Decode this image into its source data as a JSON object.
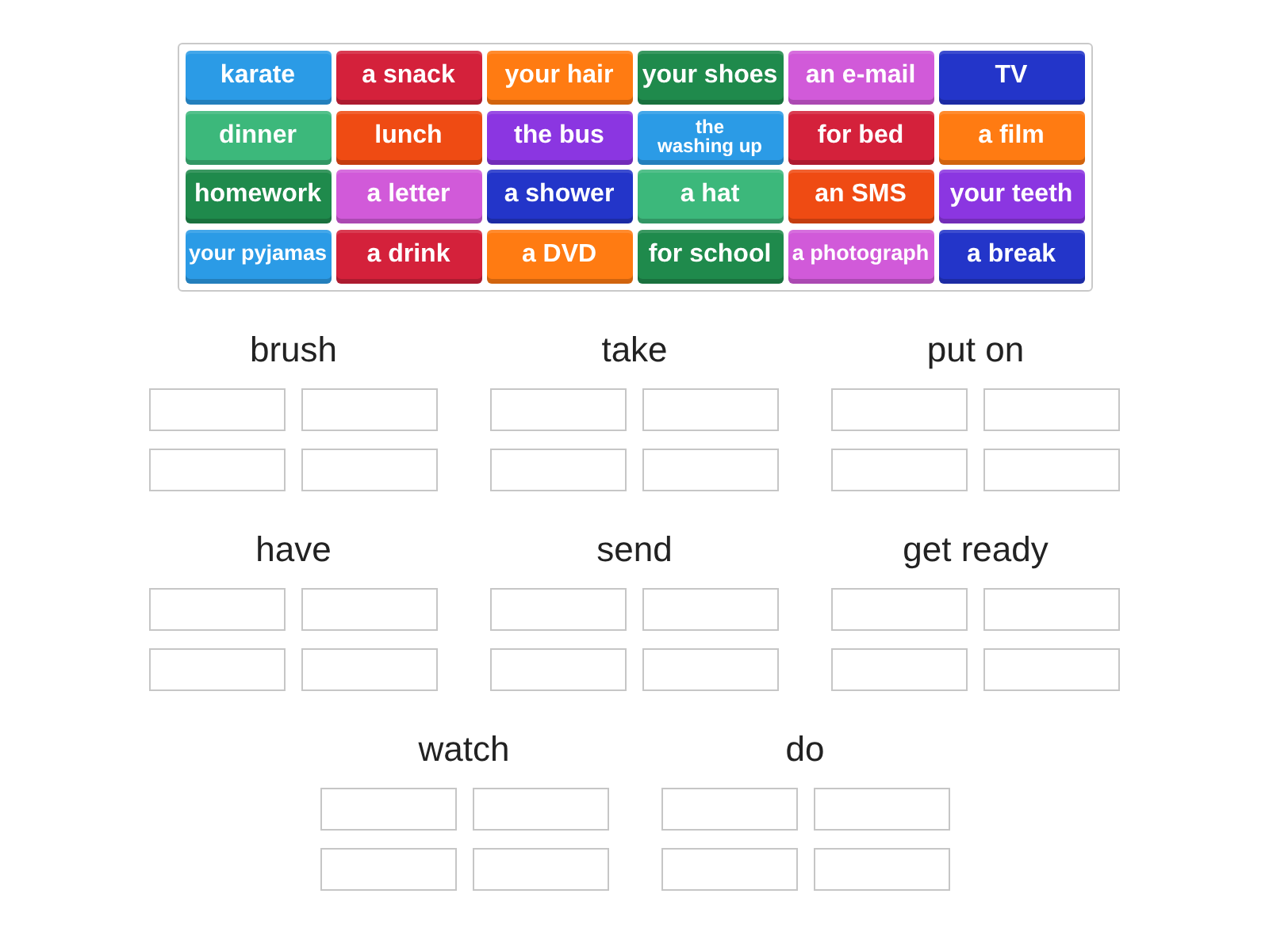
{
  "tiles": [
    {
      "label": "karate",
      "color": "#2b9be6"
    },
    {
      "label": "a snack",
      "color": "#d4213b"
    },
    {
      "label": "your hair",
      "color": "#ff7b12"
    },
    {
      "label": "your shoes",
      "color": "#1f8a4c"
    },
    {
      "label": "an e-mail",
      "color": "#d15ad9"
    },
    {
      "label": "TV",
      "color": "#2335c9"
    },
    {
      "label": "dinner",
      "color": "#3cb87b"
    },
    {
      "label": "lunch",
      "color": "#ef4b13"
    },
    {
      "label": "the bus",
      "color": "#8b36e1"
    },
    {
      "label": "the washing up",
      "color": "#2b9be6"
    },
    {
      "label": "for bed",
      "color": "#d4213b"
    },
    {
      "label": "a film",
      "color": "#ff7b12"
    },
    {
      "label": "homework",
      "color": "#1f8a4c"
    },
    {
      "label": "a letter",
      "color": "#d15ad9"
    },
    {
      "label": "a shower",
      "color": "#2335c9"
    },
    {
      "label": "a hat",
      "color": "#3cb87b"
    },
    {
      "label": "an SMS",
      "color": "#ef4b13"
    },
    {
      "label": "your teeth",
      "color": "#8b36e1"
    },
    {
      "label": "your pyjamas",
      "color": "#2b9be6"
    },
    {
      "label": "a drink",
      "color": "#d4213b"
    },
    {
      "label": "a DVD",
      "color": "#ff7b12"
    },
    {
      "label": "for school",
      "color": "#1f8a4c"
    },
    {
      "label": "a photograph",
      "color": "#d15ad9"
    },
    {
      "label": "a break",
      "color": "#2335c9"
    }
  ],
  "groups": [
    {
      "title": "brush"
    },
    {
      "title": "take"
    },
    {
      "title": "put on"
    },
    {
      "title": "have"
    },
    {
      "title": "send"
    },
    {
      "title": "get ready"
    },
    {
      "title": "watch"
    },
    {
      "title": "do"
    }
  ]
}
